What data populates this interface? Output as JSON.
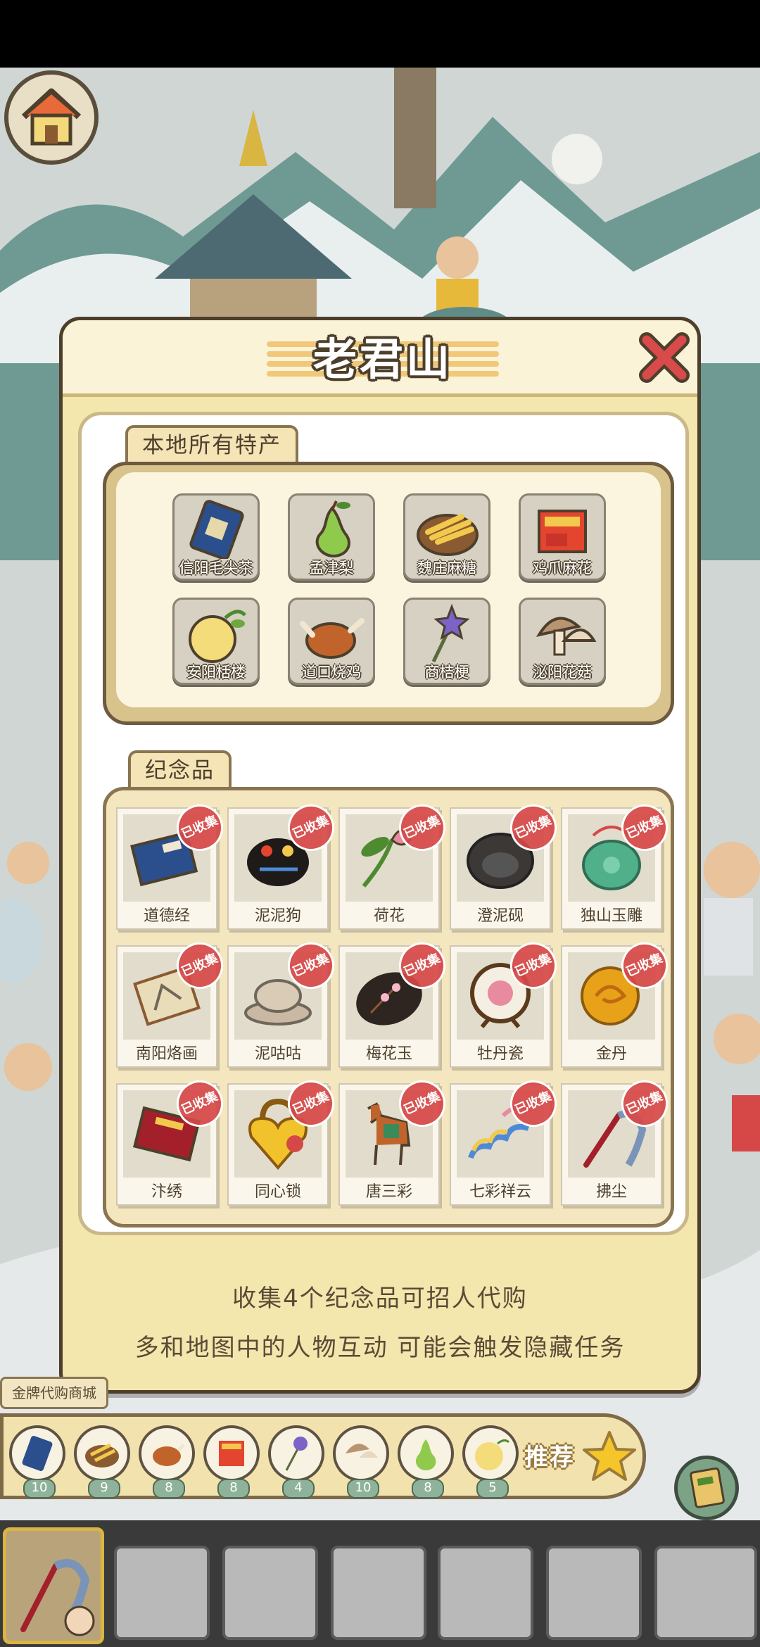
{
  "location_title": "老君山",
  "local_specialties": {
    "label": "本地所有特产",
    "items": [
      {
        "name": "信阳毛尖茶",
        "icon": "tea-pack-icon"
      },
      {
        "name": "孟津梨",
        "icon": "pear-icon"
      },
      {
        "name": "魏庄麻糖",
        "icon": "sugar-twist-basket-icon"
      },
      {
        "name": "鸡爪麻花",
        "icon": "snack-box-icon"
      },
      {
        "name": "安阳栝楼",
        "icon": "melon-icon"
      },
      {
        "name": "道口烧鸡",
        "icon": "roast-chicken-icon"
      },
      {
        "name": "商桔梗",
        "icon": "balloon-flower-icon"
      },
      {
        "name": "泌阳花菇",
        "icon": "mushroom-icon"
      }
    ]
  },
  "souvenirs": {
    "label": "纪念品",
    "collected_stamp": "已收集",
    "items": [
      {
        "name": "道德经",
        "icon": "blue-book-icon"
      },
      {
        "name": "泥泥狗",
        "icon": "clay-dog-icon"
      },
      {
        "name": "荷花",
        "icon": "lotus-icon"
      },
      {
        "name": "澄泥砚",
        "icon": "inkstone-icon"
      },
      {
        "name": "独山玉雕",
        "icon": "jade-carving-icon"
      },
      {
        "name": "南阳烙画",
        "icon": "scroll-painting-icon"
      },
      {
        "name": "泥咕咕",
        "icon": "clay-whistle-icon"
      },
      {
        "name": "梅花玉",
        "icon": "plum-jade-icon"
      },
      {
        "name": "牡丹瓷",
        "icon": "peony-porcelain-icon"
      },
      {
        "name": "金丹",
        "icon": "golden-pill-icon"
      },
      {
        "name": "汴绣",
        "icon": "embroidery-box-icon"
      },
      {
        "name": "同心锁",
        "icon": "heart-lock-icon"
      },
      {
        "name": "唐三彩",
        "icon": "tang-horse-icon"
      },
      {
        "name": "七彩祥云",
        "icon": "rainbow-cloud-icon"
      },
      {
        "name": "拂尘",
        "icon": "whisk-icon"
      }
    ]
  },
  "info": {
    "line1": "收集4个纪念品可招人代购",
    "line2": "多和地图中的人物互动 可能会触发隐藏任务"
  },
  "bottom": {
    "golden_label": "金牌代购商城",
    "recommend_label": "推荐",
    "recommend_items": [
      {
        "icon": "tea-pack-icon",
        "count": "10"
      },
      {
        "icon": "sugar-twist-basket-icon",
        "count": "9"
      },
      {
        "icon": "roast-chicken-icon",
        "count": "8"
      },
      {
        "icon": "snack-box-icon",
        "count": "8"
      },
      {
        "icon": "balloon-flower-icon",
        "count": "4"
      },
      {
        "icon": "mushroom-icon",
        "count": "10"
      },
      {
        "icon": "pear-icon",
        "count": "8"
      },
      {
        "icon": "melon-icon",
        "count": "5"
      }
    ]
  },
  "colors": {
    "panel_bg": "#f4e7ae",
    "outline": "#4d3f2c",
    "stamp": "#d64848",
    "close_x": "#d94a4a"
  }
}
